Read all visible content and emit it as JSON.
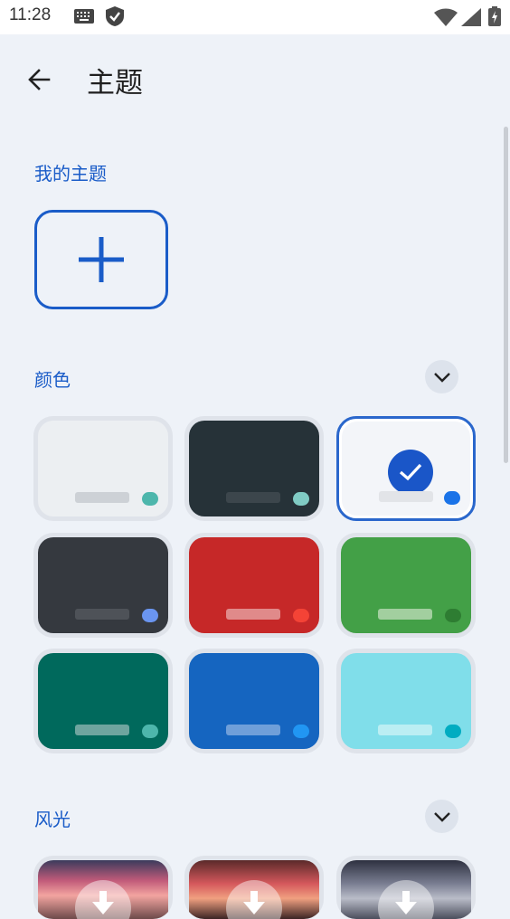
{
  "status_bar": {
    "time": "11:28"
  },
  "header": {
    "title": "主题",
    "back_icon": "arrow-left-icon"
  },
  "my_themes": {
    "label": "我的主题",
    "add_icon": "plus-icon"
  },
  "colors": {
    "label": "颜色",
    "expand_icon": "chevron-down-icon",
    "tiles": [
      {
        "name": "light-gray",
        "bg": "#eceff2",
        "bar": "#cdd1d6",
        "dot": "#4db6ac",
        "selected": false
      },
      {
        "name": "dark-slate",
        "bg": "#263238",
        "bar": "#3c464c",
        "dot": "#80cbc4",
        "selected": false
      },
      {
        "name": "white-blue",
        "bg": "#f3f5f9",
        "bar": "#e2e4e8",
        "dot": "#1a73e8",
        "selected": true
      },
      {
        "name": "dark-gray",
        "bg": "#35393f",
        "bar": "#4e5258",
        "dot": "#6a95f0",
        "selected": false
      },
      {
        "name": "red",
        "bg": "#c62828",
        "bar": "#e08a8a",
        "dot": "#f44336",
        "selected": false
      },
      {
        "name": "green",
        "bg": "#43a047",
        "bar": "#a2cf9f",
        "dot": "#2e7d32",
        "selected": false
      },
      {
        "name": "teal",
        "bg": "#00695c",
        "bar": "#6ea59f",
        "dot": "#4db6ac",
        "selected": false
      },
      {
        "name": "blue",
        "bg": "#1565c0",
        "bar": "#6f9fd9",
        "dot": "#2196f3",
        "selected": false
      },
      {
        "name": "cyan",
        "bg": "#80deea",
        "bar": "#bbeef3",
        "dot": "#00acc1",
        "selected": false
      }
    ]
  },
  "scenery": {
    "label": "风光",
    "expand_icon": "chevron-down-icon",
    "download_icon": "download-icon"
  },
  "accent_color": "#1a5cc8"
}
